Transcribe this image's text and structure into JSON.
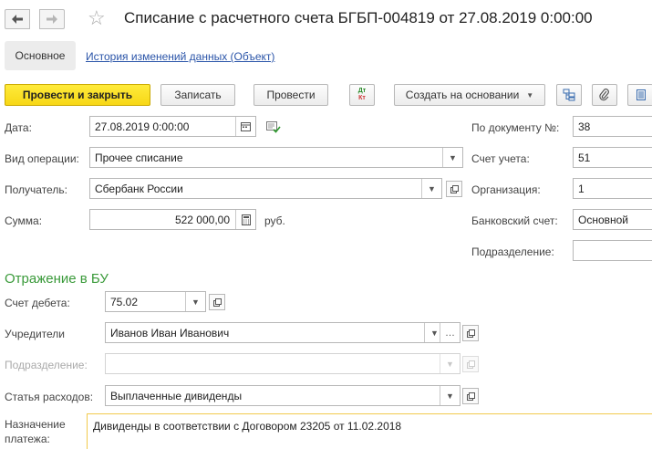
{
  "window": {
    "title": "Списание с расчетного счета БГБП-004819 от 27.08.2019 0:00:00"
  },
  "nav": {
    "back_icon": "arrow-left-icon",
    "forward_icon": "arrow-right-icon",
    "favorite_icon": "star-icon"
  },
  "tabs": {
    "main": "Основное",
    "history": "История изменений данных (Объект)"
  },
  "toolbar": {
    "post_close": "Провести и закрыть",
    "save": "Записать",
    "post": "Провести",
    "dtkt_top": "Дт",
    "dtkt_bottom": "Кт",
    "create_based": "Создать на основании"
  },
  "form": {
    "date_label": "Дата:",
    "date_value": "27.08.2019  0:00:00",
    "operation_label": "Вид операции:",
    "operation_value": "Прочее списание",
    "recipient_label": "Получатель:",
    "recipient_value": "Сбербанк России",
    "amount_label": "Сумма:",
    "amount_value": "522 000,00",
    "currency": "руб.",
    "doc_number_label": "По документу №:",
    "doc_number_value": "38",
    "account_label": "Счет учета:",
    "account_value": "51",
    "org_label": "Организация:",
    "org_value": "1",
    "bank_account_label": "Банковский счет:",
    "bank_account_value": "Основной",
    "division_label": "Подразделение:",
    "division_value": ""
  },
  "accounting": {
    "heading": "Отражение в БУ",
    "debit_label": "Счет дебета:",
    "debit_value": "75.02",
    "founders_label": "Учредители",
    "founders_value": "Иванов Иван Иванович",
    "division_label": "Подразделение:",
    "division_value": "",
    "expense_label": "Статья расходов:",
    "expense_value": "Выплаченные дивиденды",
    "purpose_label_1": "Назначение",
    "purpose_label_2": "платежа:",
    "purpose_value": "Дивиденды в соответствии с Договором 23205 от 11.02.2018"
  },
  "colors": {
    "primary_button": "#f7d716",
    "section_heading": "#3a9a3a",
    "link": "#2a54a8",
    "focus_border": "#f2c94c"
  }
}
